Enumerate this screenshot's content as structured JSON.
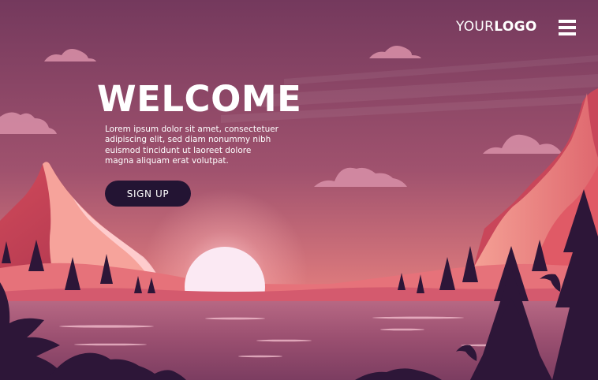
{
  "header": {
    "logo": {
      "light": "YOUR",
      "bold": "LOGO"
    },
    "menu_icon": "hamburger-menu-icon"
  },
  "hero": {
    "title": "WELCOME",
    "body_lines": [
      "Lorem ipsum dolor sit amet, consectetuer",
      "adipiscing elit, sed diam nonummy nibh",
      "euismod tincidunt ut laoreet dolore",
      "magna aliquam erat volutpat."
    ],
    "cta_label": "SIGN UP"
  },
  "colors": {
    "sky_top": "#74395d",
    "sky_bottom": "#ef8a86",
    "sun": "#fbe9f3",
    "mountain_light": "#f59a92",
    "mountain_dark": "#c03b51",
    "lake": "#a45674",
    "silhouette": "#2d1638",
    "button": "#231433",
    "text": "#ffffff"
  }
}
